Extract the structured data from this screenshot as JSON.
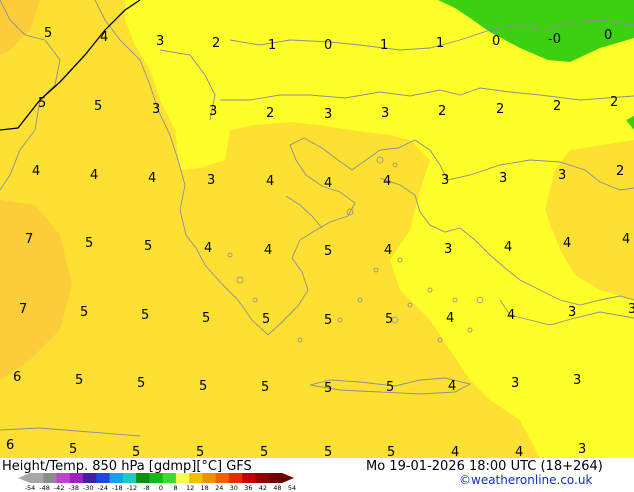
{
  "map": {
    "colors": {
      "t_below_2": "#3cd010",
      "t_2_4": "#fefe28",
      "t_4_6": "#fde032",
      "t_6_8": "#fccc3a",
      "coast": "#8a8f9a",
      "isoline": "#000000"
    },
    "isotherm_labels": [
      {
        "v": "5"
      },
      {
        "v": "4"
      },
      {
        "v": "3"
      },
      {
        "v": "2"
      },
      {
        "v": "1"
      },
      {
        "v": "0"
      },
      {
        "v": "1"
      },
      {
        "v": "1"
      },
      {
        "v": "0"
      },
      {
        "v": "-0"
      },
      {
        "v": "0"
      },
      {
        "v": "5"
      },
      {
        "v": "5"
      },
      {
        "v": "3"
      },
      {
        "v": "3"
      },
      {
        "v": "2"
      },
      {
        "v": "3"
      },
      {
        "v": "3"
      },
      {
        "v": "2"
      },
      {
        "v": "2"
      },
      {
        "v": "2"
      },
      {
        "v": "2"
      },
      {
        "v": "4"
      },
      {
        "v": "4"
      },
      {
        "v": "4"
      },
      {
        "v": "3"
      },
      {
        "v": "4"
      },
      {
        "v": "4"
      },
      {
        "v": "4"
      },
      {
        "v": "3"
      },
      {
        "v": "3"
      },
      {
        "v": "3"
      },
      {
        "v": "2"
      },
      {
        "v": "7"
      },
      {
        "v": "5"
      },
      {
        "v": "5"
      },
      {
        "v": "4"
      },
      {
        "v": "4"
      },
      {
        "v": "5"
      },
      {
        "v": "4"
      },
      {
        "v": "3"
      },
      {
        "v": "4"
      },
      {
        "v": "4"
      },
      {
        "v": "4"
      },
      {
        "v": "7"
      },
      {
        "v": "5"
      },
      {
        "v": "5"
      },
      {
        "v": "5"
      },
      {
        "v": "5"
      },
      {
        "v": "5"
      },
      {
        "v": "5"
      },
      {
        "v": "4"
      },
      {
        "v": "4"
      },
      {
        "v": "3"
      },
      {
        "v": "3"
      },
      {
        "v": "6"
      },
      {
        "v": "5"
      },
      {
        "v": "5"
      },
      {
        "v": "5"
      },
      {
        "v": "5"
      },
      {
        "v": "5"
      },
      {
        "v": "5"
      },
      {
        "v": "4"
      },
      {
        "v": "3"
      },
      {
        "v": "3"
      },
      {
        "v": "6"
      },
      {
        "v": "5"
      },
      {
        "v": "5"
      },
      {
        "v": "5"
      },
      {
        "v": "5"
      },
      {
        "v": "5"
      },
      {
        "v": "5"
      },
      {
        "v": "4"
      },
      {
        "v": "4"
      },
      {
        "v": "3"
      }
    ]
  },
  "footer": {
    "title": "Height/Temp. 850 hPa [gdmp][°C] GFS",
    "datetime": "Mo 19-01-2026 18:00 UTC (18+264)",
    "credit": "©weatheronline.co.uk"
  },
  "legend": {
    "ticks": [
      "-54",
      "-48",
      "-42",
      "-38",
      "-30",
      "-24",
      "-18",
      "-12",
      "-8",
      "0",
      "8",
      "12",
      "18",
      "24",
      "30",
      "36",
      "42",
      "48",
      "54"
    ],
    "colors": [
      "#a8a8a8",
      "#8c8c8c",
      "#c040d0",
      "#a020c0",
      "#4020a0",
      "#2048d8",
      "#18a0e8",
      "#20c8c8",
      "#109010",
      "#18b818",
      "#40d830",
      "#f8f858",
      "#f0c000",
      "#f09000",
      "#f06000",
      "#e03000",
      "#c00000",
      "#900000",
      "#700000"
    ]
  }
}
